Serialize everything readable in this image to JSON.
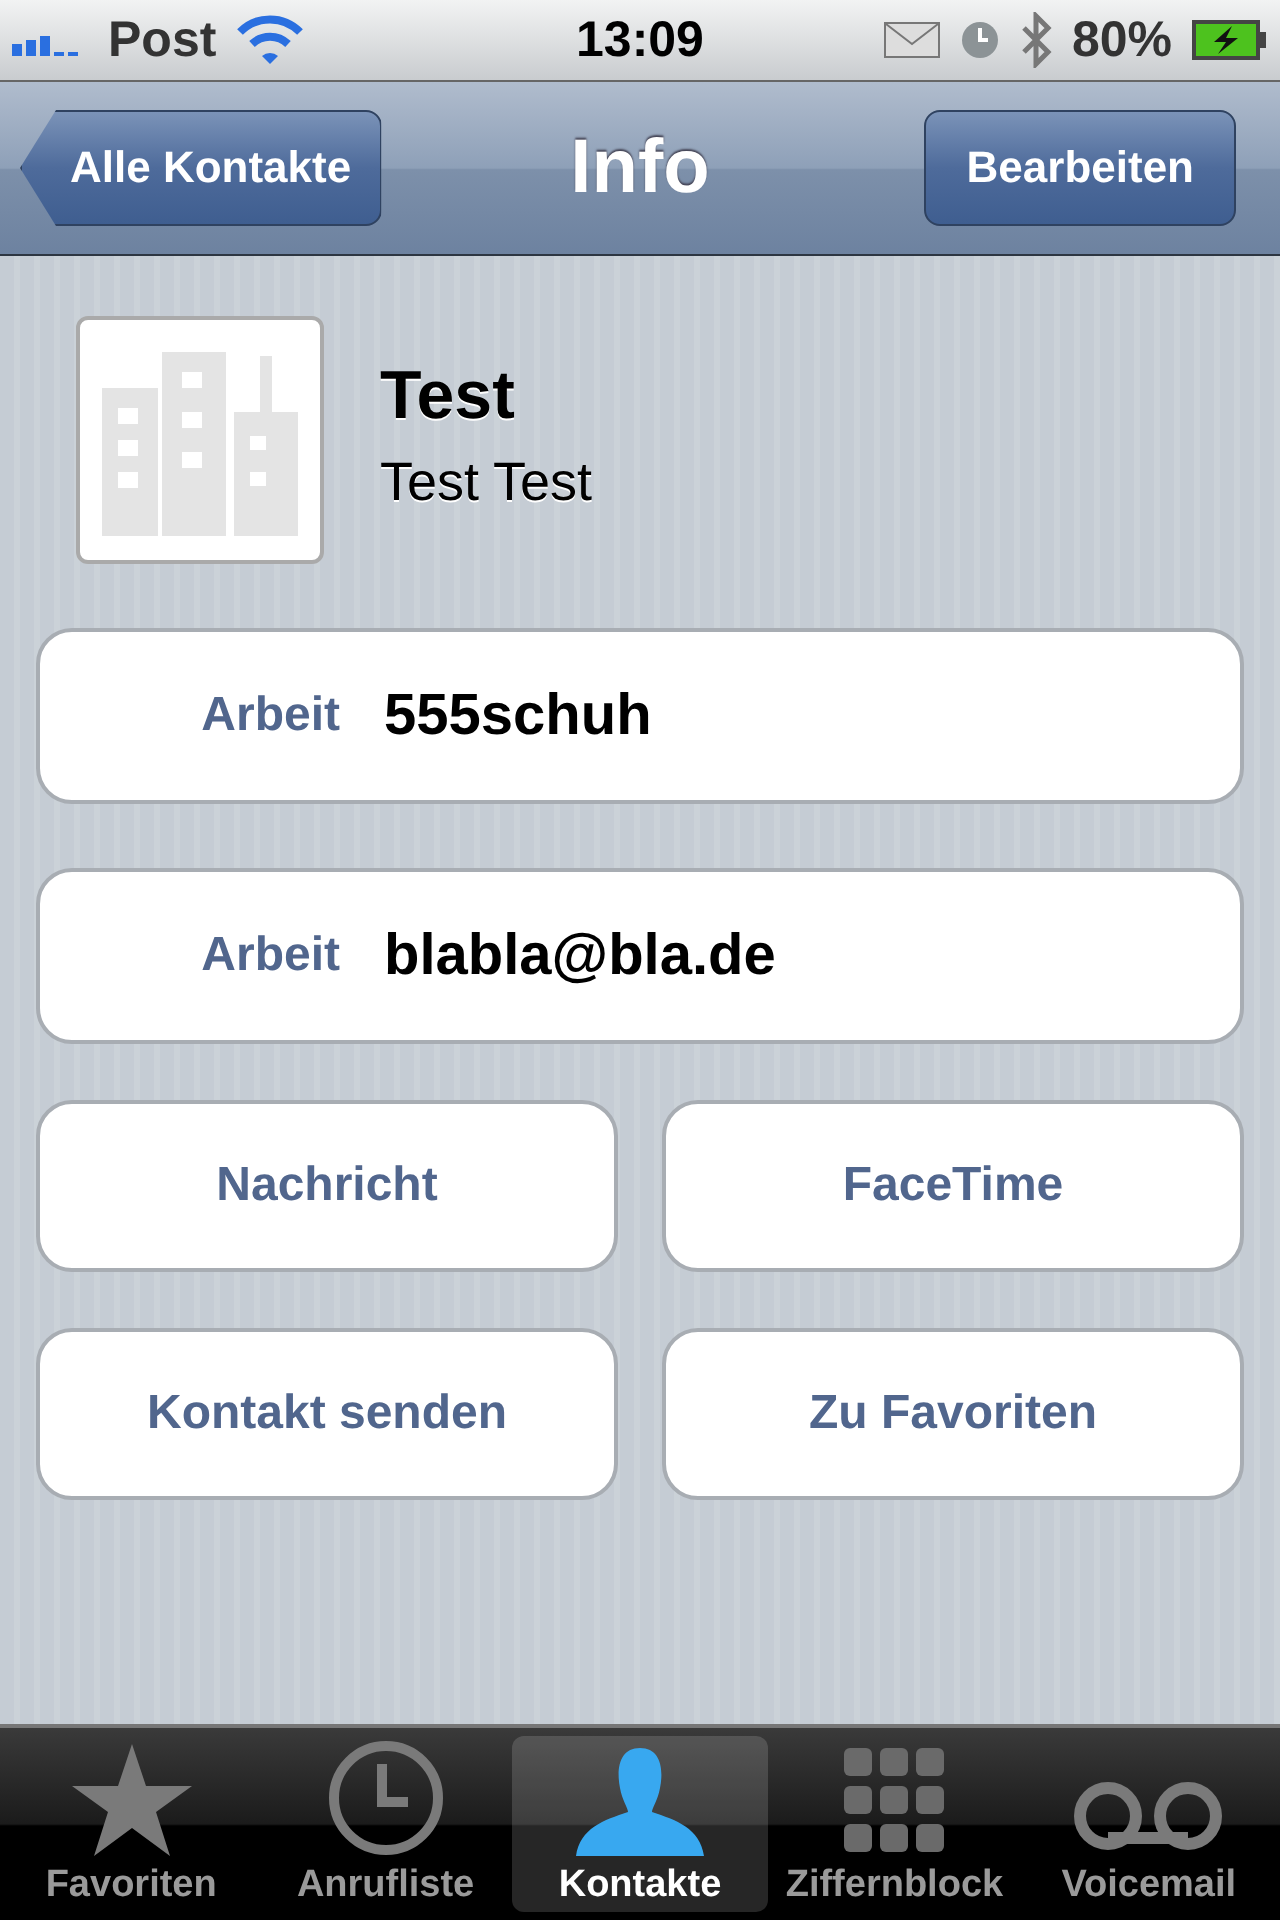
{
  "status_bar": {
    "carrier": "Post",
    "time": "13:09",
    "battery": "80%"
  },
  "nav": {
    "back": "Alle Kontakte",
    "title": "Info",
    "action": "Bearbeiten"
  },
  "contact": {
    "name": "Test",
    "subtitle": "Test Test"
  },
  "fields": [
    {
      "label": "Arbeit",
      "value": "555schuh"
    },
    {
      "label": "Arbeit",
      "value": "blabla@bla.de"
    }
  ],
  "action_buttons": [
    [
      "Nachricht",
      "FaceTime"
    ],
    [
      "Kontakt senden",
      "Zu Favoriten"
    ]
  ],
  "tab_bar": [
    {
      "label": "Favoriten",
      "kind": "star",
      "selected": false
    },
    {
      "label": "Anrufliste",
      "kind": "clock",
      "selected": false
    },
    {
      "label": "Kontakte",
      "kind": "person",
      "selected": true
    },
    {
      "label": "Ziffernblock",
      "kind": "keypad",
      "selected": false
    },
    {
      "label": "Voicemail",
      "kind": "voicemail",
      "selected": false
    }
  ]
}
